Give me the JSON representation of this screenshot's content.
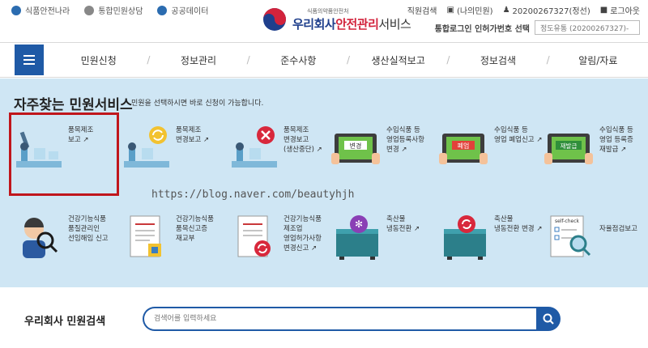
{
  "util_left": [
    {
      "label": "식품안전나라",
      "icon": "home-icon"
    },
    {
      "label": "통합민원상담",
      "icon": "consult-icon"
    },
    {
      "label": "공공데이터",
      "icon": "data-icon"
    }
  ],
  "logo": {
    "small": "식품의약품안전처",
    "main_blue": "우리회사",
    "main_red": "안전관리",
    "main_rest": "서비스"
  },
  "util_right": [
    {
      "label": "직원검색"
    },
    {
      "label": "(나의민원)"
    },
    {
      "label": "20200267327(정선)"
    },
    {
      "label": "로그아웃"
    }
  ],
  "license": {
    "label": "통합로그인 인허가번호 선택",
    "selected": "정도유통 (20200267327)-"
  },
  "nav": {
    "items": [
      "민원신청",
      "정보관리",
      "준수사항",
      "생산실적보고",
      "정보검색",
      "알림/자료"
    ]
  },
  "favorites": {
    "title": "자주찾는 민원서비스",
    "subtitle": "민원을 선택하시면 바로 신청이 가능합니다.",
    "row1": [
      {
        "lines": [
          "품목제조",
          "보고 ↗"
        ],
        "icon": "robot-arm-icon"
      },
      {
        "lines": [
          "품목제조",
          "변경보고 ↗"
        ],
        "icon": "robot-arm-change-icon"
      },
      {
        "lines": [
          "품목제조",
          "변경보고",
          "(생산중단) ↗"
        ],
        "icon": "robot-arm-stop-icon"
      },
      {
        "lines": [
          "수입식품 등",
          "영업등록사항",
          "변경 ↗"
        ],
        "icon": "tablet-change-icon",
        "badge": "변경"
      },
      {
        "lines": [
          "수입식품 등",
          "영업 폐업신고 ↗"
        ],
        "icon": "tablet-close-icon",
        "badge": "폐업"
      },
      {
        "lines": [
          "수입식품 등",
          "영업 등록증",
          "재발급 ↗"
        ],
        "icon": "tablet-reissue-icon",
        "badge": "재발급"
      }
    ],
    "row2": [
      {
        "lines": [
          "건강기능식품",
          "품질관리인",
          "선임해임 신고"
        ],
        "icon": "inspector-icon"
      },
      {
        "lines": [
          "건강기능식품",
          "품목신고증",
          "재교부"
        ],
        "icon": "document-icon"
      },
      {
        "lines": [
          "건강기능식품",
          "제조업",
          "영업허가사항",
          "변경신고 ↗"
        ],
        "icon": "document-change-icon"
      },
      {
        "lines": [
          "축산물",
          "냉동전환 ↗"
        ],
        "icon": "freezer-icon"
      },
      {
        "lines": [
          "축산물",
          "냉동전환 변경 ↗"
        ],
        "icon": "freezer-change-icon"
      },
      {
        "lines": [
          "자율점검보고"
        ],
        "icon": "self-check-icon",
        "badge": "self-check"
      }
    ]
  },
  "watermark": "https://blog.naver.com/beautyhjh",
  "search": {
    "label": "우리회사 민원검색",
    "placeholder": "검색어를 입력하세요"
  }
}
